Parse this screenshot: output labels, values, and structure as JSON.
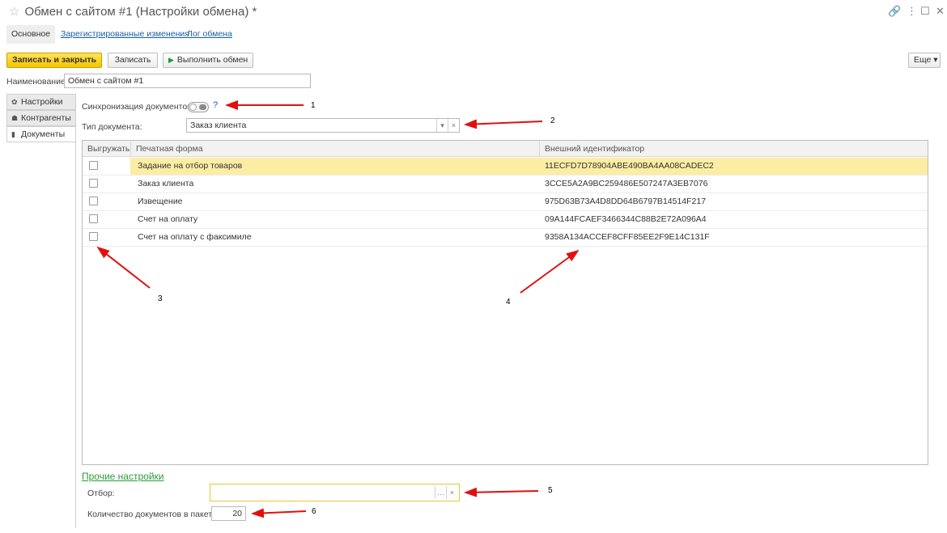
{
  "window": {
    "title": "Обмен с сайтом #1 (Настройки обмена) *",
    "star_icon": "star-icon",
    "link_icon": "link-icon",
    "menu_icon": "more-vert-icon",
    "maximize_icon": "maximize-icon",
    "close_icon": "close-icon"
  },
  "nav": {
    "tabs": [
      "Основное",
      "Зарегистрированные изменения",
      "Лог обмена"
    ]
  },
  "toolbar": {
    "save_close": "Записать и закрыть",
    "save": "Записать",
    "run": "Выполнить обмен",
    "more": "Еще ▾"
  },
  "name": {
    "label": "Наименование:",
    "value": "Обмен с сайтом #1"
  },
  "side_tabs": [
    "Настройки",
    "Контрагенты",
    "Документы"
  ],
  "sync": {
    "label": "Синхронизация документов:",
    "help": "?"
  },
  "doc_type": {
    "label": "Тип документа:",
    "value": "Заказ клиента"
  },
  "table": {
    "columns": [
      "Выгружать",
      "Печатная форма",
      "Внешний идентификатор"
    ],
    "rows": [
      {
        "form": "Задание на отбор товаров",
        "id": "11ECFD7D78904ABE490BA4AA08CADEC2"
      },
      {
        "form": "Заказ клиента",
        "id": "3CCE5A2A9BC259486E507247A3EB7076"
      },
      {
        "form": "Извещение",
        "id": "975D63B73A4D8DD64B6797B14514F217"
      },
      {
        "form": "Счет на оплату",
        "id": "09A144FCAEF3466344C88B2E72A096A4"
      },
      {
        "form": "Счет на оплату с факсимиле",
        "id": "9358A134ACCEF8CFF85EE2F9E14C131F"
      }
    ]
  },
  "other": {
    "title": "Прочие настройки",
    "filter_label": "Отбор:",
    "filter_value": "",
    "count_label": "Количество документов в пакете:",
    "count_value": "20"
  },
  "annotations": [
    "1",
    "2",
    "3",
    "4",
    "5",
    "6"
  ],
  "colors": {
    "accent_yellow": "#f5c500",
    "link_blue": "#1a5fa8",
    "section_green": "#2e9a3a",
    "selected_row": "#fbeda3",
    "arrow_red": "#e01010"
  }
}
